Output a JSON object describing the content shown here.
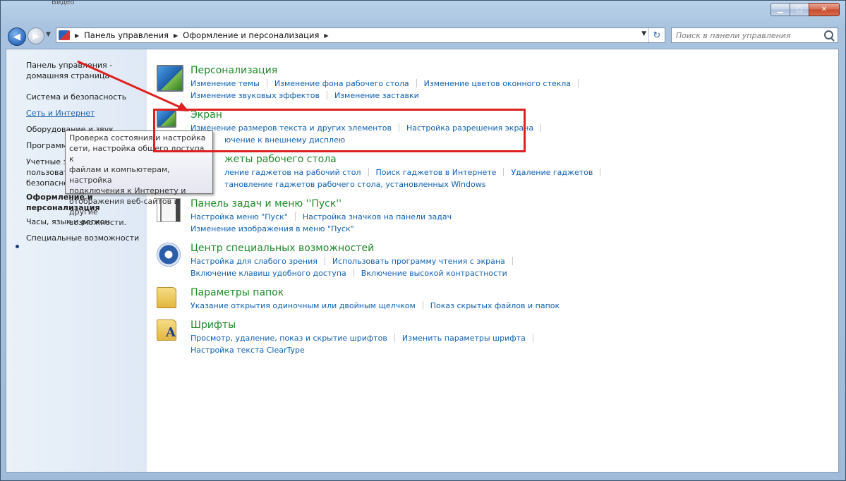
{
  "titlebar": {
    "strip_text": "Видео"
  },
  "window_controls": {
    "minimize": "▁",
    "maximize": "□",
    "close": "✕"
  },
  "nav": {
    "back": "◀",
    "forward": "▶",
    "history": "▼"
  },
  "address": {
    "breadcrumbs": [
      "Панель управления",
      "Оформление и персонализация"
    ],
    "dropdown": "▼",
    "refresh": "↻"
  },
  "search": {
    "placeholder": "Поиск в панели управления"
  },
  "sidebar": {
    "home": [
      "Панель управления -",
      "домашняя страница"
    ],
    "items": [
      "Система и безопасность",
      "Сеть и Интернет",
      "Оборудование и звук",
      "Программы",
      "Учетные записи пользователей и семейная безопасность",
      "Оформление и персонализация",
      "Часы, язык и регион",
      "Специальные возможности"
    ],
    "visible_fragments": {
      "hardware": "Оборудование и звук",
      "programs": "Программ",
      "accounts": [
        "Учетные з",
        "пользоват",
        "безопасно"
      ],
      "current": [
        "Оформление и",
        "персонализация"
      ]
    }
  },
  "tooltip": {
    "lines": [
      "Проверка состояния и настройка",
      "сети, настройка общего доступа к",
      "файлам и компьютерам, настройка",
      "подключения к Интернету и",
      "отображения веб-сайтов и другие",
      "возможности."
    ]
  },
  "categories": [
    {
      "title": "Персонализация",
      "rows": [
        [
          "Изменение темы",
          "Изменение фона рабочего стола",
          "Изменение цветов оконного стекла"
        ],
        [
          "Изменение звуковых эффектов",
          "Изменение заставки"
        ]
      ]
    },
    {
      "title": "Экран",
      "rows": [
        [
          "Изменение размеров текста и других элементов",
          "Настройка разрешения экрана"
        ],
        [
          "Подключение к внешнему дисплею"
        ]
      ],
      "visible_row2": "ючение к внешнему дисплею"
    },
    {
      "title": "Гаджеты рабочего стола",
      "visible_title": "жеты рабочего стола",
      "rows": [
        [
          "Добавление гаджетов на рабочий стол",
          "Поиск гаджетов в Интернете",
          "Удаление гаджетов"
        ],
        [
          "Восстановление гаджетов рабочего стола, установленных Windows"
        ]
      ],
      "visible_rows": [
        "ление гаджетов на рабочий стол",
        "тановление гаджетов рабочего стола, установленных Windows"
      ]
    },
    {
      "title": "Панель задач и меню ''Пуск''",
      "rows": [
        [
          "Настройка меню \"Пуск\"",
          "Настройка значков на панели задач"
        ],
        [
          "Изменение изображения в меню \"Пуск\""
        ]
      ]
    },
    {
      "title": "Центр специальных возможностей",
      "rows": [
        [
          "Настройка для слабого зрения",
          "Использовать программу чтения с экрана"
        ],
        [
          "Включение клавиш удобного доступа",
          "Включение высокой контрастности"
        ]
      ]
    },
    {
      "title": "Параметры папок",
      "rows": [
        [
          "Указание открытия одиночным или двойным щелчком",
          "Показ скрытых файлов и папок"
        ]
      ]
    },
    {
      "title": "Шрифты",
      "rows": [
        [
          "Просмотр, удаление, показ и скрытие шрифтов",
          "Изменить параметры шрифта"
        ],
        [
          "Настройка текста ClearType"
        ]
      ]
    }
  ],
  "colors": {
    "link": "#1060b0",
    "category_title": "#1f8a2a",
    "annotation": "#e02020"
  }
}
